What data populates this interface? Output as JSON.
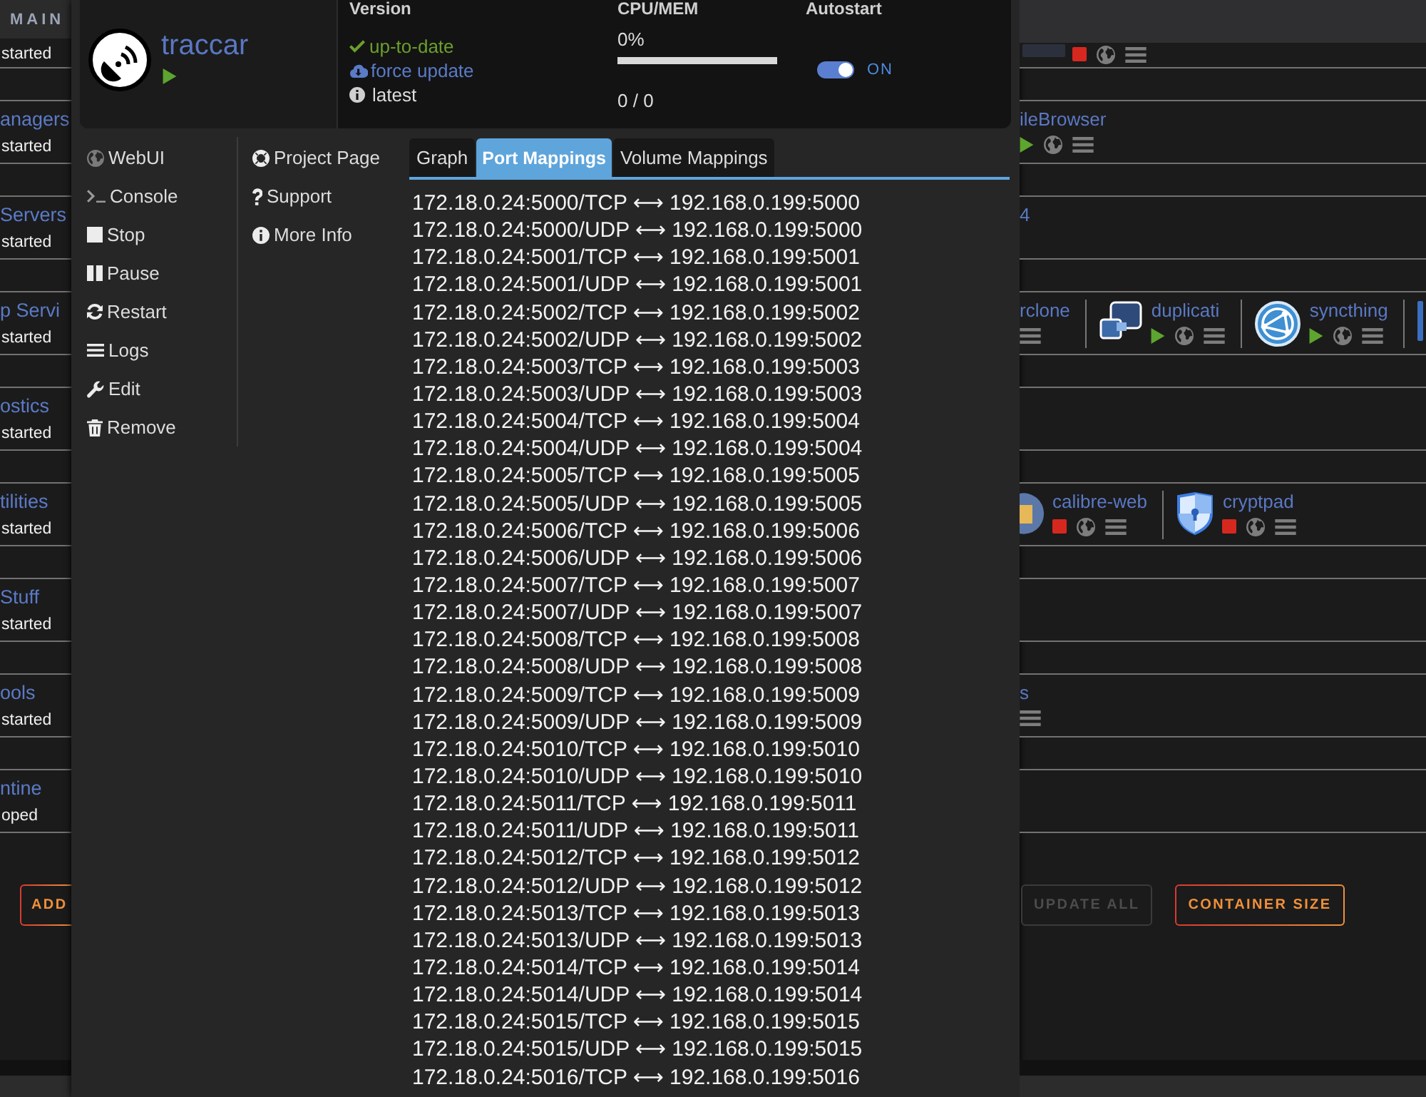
{
  "background": {
    "section_tab": "MAIN",
    "rows": [
      {
        "category": {
          "status_text": "started"
        },
        "apps": [
          {
            "logo": true,
            "running": false,
            "webui": true,
            "menu": true
          }
        ]
      },
      {
        "category": {
          "name": "anagers",
          "status_text": "started"
        },
        "apps": [
          {
            "name": "ileBrowser",
            "running": true,
            "webui": true,
            "menu": true
          }
        ]
      },
      {
        "category": {
          "name": "Servers",
          "status_text": "started"
        },
        "apps": [
          {
            "name": "4"
          }
        ]
      },
      {
        "category": {
          "name": "p Servi",
          "status_text": "started"
        },
        "apps": [
          {
            "name": "rclone",
            "menu": true
          },
          {
            "logo": true,
            "name": "duplicati",
            "running": true,
            "webui": true,
            "menu": true
          },
          {
            "logo": true,
            "name": "syncthing",
            "running": true,
            "webui": true,
            "menu": true
          },
          {
            "logo": true
          }
        ]
      },
      {
        "category": {
          "name": "ostics",
          "status_text": "started"
        }
      },
      {
        "category": {
          "name": "tilities",
          "status_text": "started"
        },
        "apps": [
          {
            "logo": true,
            "name": "calibre-web",
            "running": false,
            "webui": true,
            "menu": true
          },
          {
            "logo": true,
            "name": "cryptpad",
            "running": false,
            "webui": true,
            "menu": true
          }
        ]
      },
      {
        "category": {
          "name": "Stuff",
          "status_text": "started"
        }
      },
      {
        "category": {
          "name": "ools",
          "status_text": "started"
        },
        "apps": [
          {
            "name": "s",
            "menu": true
          }
        ]
      },
      {
        "category": {
          "name": "ntine",
          "status_text": "oped"
        }
      }
    ],
    "left_buttons": [
      {
        "label": "ADD",
        "disabled": false
      }
    ],
    "right_buttons": [
      {
        "label": "UPDATE ALL",
        "disabled": true
      },
      {
        "label": "CONTAINER SIZE",
        "disabled": false
      }
    ]
  },
  "dialog": {
    "container": {
      "name": "traccar",
      "running": true
    },
    "version": {
      "heading": "Version",
      "status": "up-to-date",
      "update_link": "force update",
      "tag": "latest"
    },
    "cpu_mem": {
      "heading": "CPU/MEM",
      "cpu": "0%",
      "level": 0,
      "memory": "0 / 0"
    },
    "autostart": {
      "heading": "Autostart",
      "on": true,
      "label": "ON"
    },
    "actions": [
      "WebUI",
      "Console",
      "Stop",
      "Pause",
      "Restart",
      "Logs",
      "Edit",
      "Remove"
    ],
    "links": [
      "Project Page",
      "Support",
      "More Info"
    ],
    "tabs": [
      {
        "label": "Graph",
        "selected": false
      },
      {
        "label": "Port Mappings",
        "selected": true
      },
      {
        "label": "Volume Mappings",
        "selected": false
      }
    ],
    "port_mappings": [
      "172.18.0.24:5000/TCP ⟷ 192.168.0.199:5000",
      "172.18.0.24:5000/UDP ⟷ 192.168.0.199:5000",
      "172.18.0.24:5001/TCP ⟷ 192.168.0.199:5001",
      "172.18.0.24:5001/UDP ⟷ 192.168.0.199:5001",
      "172.18.0.24:5002/TCP ⟷ 192.168.0.199:5002",
      "172.18.0.24:5002/UDP ⟷ 192.168.0.199:5002",
      "172.18.0.24:5003/TCP ⟷ 192.168.0.199:5003",
      "172.18.0.24:5003/UDP ⟷ 192.168.0.199:5003",
      "172.18.0.24:5004/TCP ⟷ 192.168.0.199:5004",
      "172.18.0.24:5004/UDP ⟷ 192.168.0.199:5004",
      "172.18.0.24:5005/TCP ⟷ 192.168.0.199:5005",
      "172.18.0.24:5005/UDP ⟷ 192.168.0.199:5005",
      "172.18.0.24:5006/TCP ⟷ 192.168.0.199:5006",
      "172.18.0.24:5006/UDP ⟷ 192.168.0.199:5006",
      "172.18.0.24:5007/TCP ⟷ 192.168.0.199:5007",
      "172.18.0.24:5007/UDP ⟷ 192.168.0.199:5007",
      "172.18.0.24:5008/TCP ⟷ 192.168.0.199:5008",
      "172.18.0.24:5008/UDP ⟷ 192.168.0.199:5008",
      "172.18.0.24:5009/TCP ⟷ 192.168.0.199:5009",
      "172.18.0.24:5009/UDP ⟷ 192.168.0.199:5009",
      "172.18.0.24:5010/TCP ⟷ 192.168.0.199:5010",
      "172.18.0.24:5010/UDP ⟷ 192.168.0.199:5010",
      "172.18.0.24:5011/TCP ⟷ 192.168.0.199:5011",
      "172.18.0.24:5011/UDP ⟷ 192.168.0.199:5011",
      "172.18.0.24:5012/TCP ⟷ 192.168.0.199:5012",
      "172.18.0.24:5012/UDP ⟷ 192.168.0.199:5012",
      "172.18.0.24:5013/TCP ⟷ 192.168.0.199:5013",
      "172.18.0.24:5013/UDP ⟷ 192.168.0.199:5013",
      "172.18.0.24:5014/TCP ⟷ 192.168.0.199:5014",
      "172.18.0.24:5014/UDP ⟷ 192.168.0.199:5014",
      "172.18.0.24:5015/TCP ⟷ 192.168.0.199:5015",
      "172.18.0.24:5015/UDP ⟷ 192.168.0.199:5015",
      "172.18.0.24:5016/TCP ⟷ 192.168.0.199:5016"
    ]
  }
}
